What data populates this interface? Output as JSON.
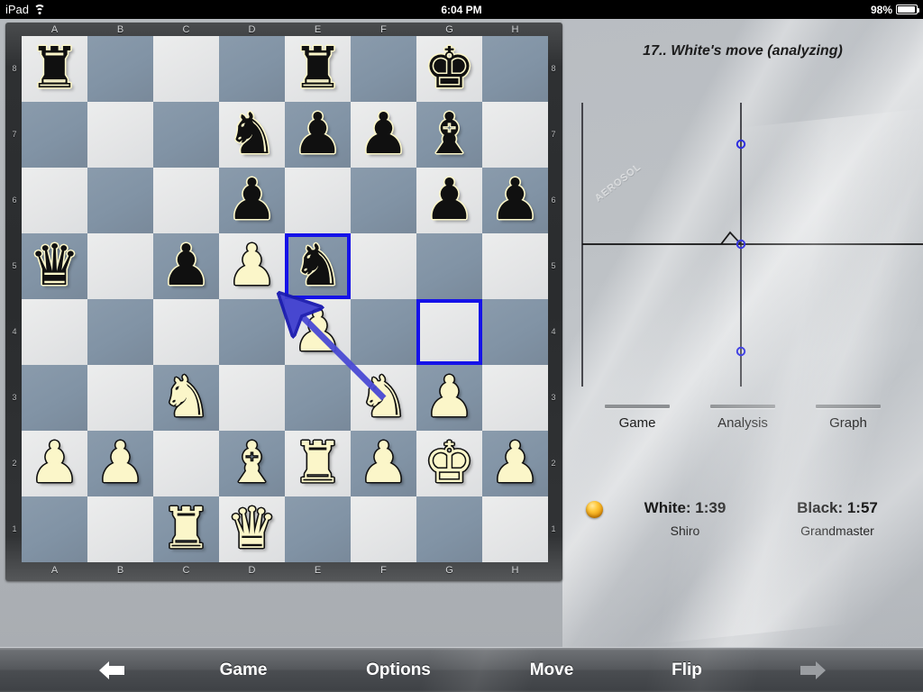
{
  "statusbar": {
    "device": "iPad",
    "wifi_icon": "wifi-icon",
    "time": "6:04 PM",
    "battery_percent": "98%",
    "battery_icon": "battery-icon"
  },
  "board": {
    "files": [
      "A",
      "B",
      "C",
      "D",
      "E",
      "F",
      "G",
      "H"
    ],
    "ranks": [
      "8",
      "7",
      "6",
      "5",
      "4",
      "3",
      "2",
      "1"
    ],
    "light_color": "#e6e7e8",
    "dark_color": "#8193a5",
    "highlight_color": "#1512e8",
    "arrow_color": "#3f3fcf",
    "arrow_from": "f3",
    "arrow_to": "e5",
    "highlighted_squares": [
      "e5",
      "g4"
    ],
    "pieces": [
      {
        "sq": "a8",
        "piece": "rook",
        "color": "black",
        "glyph": "♜"
      },
      {
        "sq": "e8",
        "piece": "rook",
        "color": "black",
        "glyph": "♜"
      },
      {
        "sq": "g8",
        "piece": "king",
        "color": "black",
        "glyph": "♚"
      },
      {
        "sq": "d7",
        "piece": "knight",
        "color": "black",
        "glyph": "♞"
      },
      {
        "sq": "e7",
        "piece": "pawn",
        "color": "black",
        "glyph": "♟"
      },
      {
        "sq": "f7",
        "piece": "pawn",
        "color": "black",
        "glyph": "♟"
      },
      {
        "sq": "g7",
        "piece": "bishop",
        "color": "black",
        "glyph": "♝"
      },
      {
        "sq": "d6",
        "piece": "pawn",
        "color": "black",
        "glyph": "♟"
      },
      {
        "sq": "g6",
        "piece": "pawn",
        "color": "black",
        "glyph": "♟"
      },
      {
        "sq": "h6",
        "piece": "pawn",
        "color": "black",
        "glyph": "♟"
      },
      {
        "sq": "a5",
        "piece": "queen",
        "color": "black",
        "glyph": "♛"
      },
      {
        "sq": "c5",
        "piece": "pawn",
        "color": "black",
        "glyph": "♟"
      },
      {
        "sq": "d5",
        "piece": "pawn",
        "color": "white",
        "glyph": "♟"
      },
      {
        "sq": "e5",
        "piece": "knight",
        "color": "black",
        "glyph": "♞"
      },
      {
        "sq": "e4",
        "piece": "pawn",
        "color": "white",
        "glyph": "♟"
      },
      {
        "sq": "c3",
        "piece": "knight",
        "color": "white",
        "glyph": "♞"
      },
      {
        "sq": "f3",
        "piece": "knight",
        "color": "white",
        "glyph": "♞"
      },
      {
        "sq": "g3",
        "piece": "pawn",
        "color": "white",
        "glyph": "♟"
      },
      {
        "sq": "a2",
        "piece": "pawn",
        "color": "white",
        "glyph": "♟"
      },
      {
        "sq": "b2",
        "piece": "pawn",
        "color": "white",
        "glyph": "♟"
      },
      {
        "sq": "d2",
        "piece": "bishop",
        "color": "white",
        "glyph": "♝"
      },
      {
        "sq": "e2",
        "piece": "rook",
        "color": "white",
        "glyph": "♜"
      },
      {
        "sq": "f2",
        "piece": "pawn",
        "color": "white",
        "glyph": "♟"
      },
      {
        "sq": "g2",
        "piece": "king",
        "color": "white",
        "glyph": "♚"
      },
      {
        "sq": "h2",
        "piece": "pawn",
        "color": "white",
        "glyph": "♟"
      },
      {
        "sq": "c1",
        "piece": "rook",
        "color": "white",
        "glyph": "♜"
      },
      {
        "sq": "d1",
        "piece": "queen",
        "color": "white",
        "glyph": "♛"
      }
    ]
  },
  "panel": {
    "move_title": "17.. White's move (analyzing)",
    "watermark": "AEROSOL",
    "tabs": [
      {
        "label": "Game"
      },
      {
        "label": "Analysis"
      },
      {
        "label": "Graph"
      }
    ],
    "clocks": {
      "turn_indicator": "white-to-move-indicator",
      "white_clock": "White: 1:39",
      "white_player": "Shiro",
      "black_clock": "Black: 1:57",
      "black_player": "Grandmaster"
    }
  },
  "chart_data": {
    "type": "line",
    "title": "",
    "xlabel": "",
    "ylabel": "",
    "grid": false,
    "legend": null,
    "axis_color": "#26262c",
    "marker_color": "#2a2ae0",
    "x_axis_y": 0,
    "series": [
      {
        "name": "evaluation",
        "x": [
          0,
          1,
          2,
          3
        ],
        "values": [
          0.0,
          0.0,
          0.45,
          0.0
        ]
      }
    ],
    "markers": [
      {
        "x": 3,
        "y": 2.2,
        "label": "best-line-upper"
      },
      {
        "x": 3,
        "y": 0.0,
        "label": "current-eval"
      },
      {
        "x": 3,
        "y": -2.4,
        "label": "best-line-lower"
      }
    ],
    "cursor_line": {
      "x": 3,
      "y_min": -3.1,
      "y_max": 3.1
    },
    "ylim": [
      -3.6,
      3.6
    ],
    "xlim": [
      0,
      4.2
    ]
  },
  "toolbar": {
    "back_icon": "back-arrow-icon",
    "items": [
      {
        "label": "Game"
      },
      {
        "label": "Options"
      },
      {
        "label": "Move"
      },
      {
        "label": "Flip"
      }
    ],
    "forward_icon": "forward-arrow-icon"
  }
}
